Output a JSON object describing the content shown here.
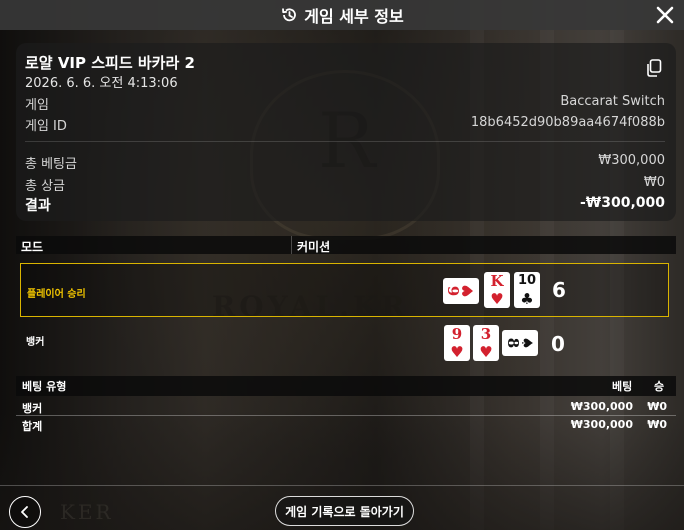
{
  "header": {
    "title": "게임 세부 정보",
    "history_icon": "history-icon",
    "close_icon": "close-icon"
  },
  "background_text": {
    "crest_letter": "R",
    "brand": "ROYAL.KR",
    "table_text": "KER"
  },
  "info": {
    "game_name": "로얄 VIP 스피드 바카라 2",
    "datetime": "2026. 6. 6. 오전 4:13:06",
    "game_label": "게임",
    "game_value": "Baccarat Switch",
    "game_id_label": "게임 ID",
    "game_id_value": "18b6452d90b89aa4674f088b",
    "total_bet_label": "총 베팅금",
    "total_bet_value": "₩300,000",
    "total_win_label": "총 상금",
    "total_win_value": "₩0",
    "result_label": "결과",
    "result_value": "-₩300,000",
    "copy_icon": "copy-icon"
  },
  "mode": {
    "mode_label": "모드",
    "commission_label": "커미션"
  },
  "hands": {
    "player": {
      "label": "플레이어 승리",
      "score": "6",
      "cards": [
        {
          "rank": "6",
          "suit": "♥",
          "color": "red",
          "sideways": true
        },
        {
          "rank": "K",
          "suit": "♥",
          "color": "red",
          "sideways": false
        },
        {
          "rank": "10",
          "suit": "♣",
          "color": "black",
          "sideways": false
        }
      ]
    },
    "banker": {
      "label": "뱅커",
      "score": "0",
      "cards": [
        {
          "rank": "9",
          "suit": "♥",
          "color": "red",
          "sideways": false
        },
        {
          "rank": "3",
          "suit": "♥",
          "color": "red",
          "sideways": false
        },
        {
          "rank": "8",
          "suit": "♠",
          "color": "black",
          "sideways": true
        }
      ]
    }
  },
  "bets": {
    "headers": {
      "type": "베팅 유형",
      "bet": "베팅",
      "win": "승"
    },
    "rows": [
      {
        "type": "뱅커",
        "bet": "₩300,000",
        "win": "₩0"
      },
      {
        "type": "합계",
        "bet": "₩300,000",
        "win": "₩0"
      }
    ]
  },
  "footer": {
    "back_icon": "chevron-left-icon",
    "history_button": "게임 기록으로 돌아가기"
  },
  "colors": {
    "highlight_border": "#d9b400",
    "player_label": "#f0c400",
    "card_red": "#d3212e"
  }
}
